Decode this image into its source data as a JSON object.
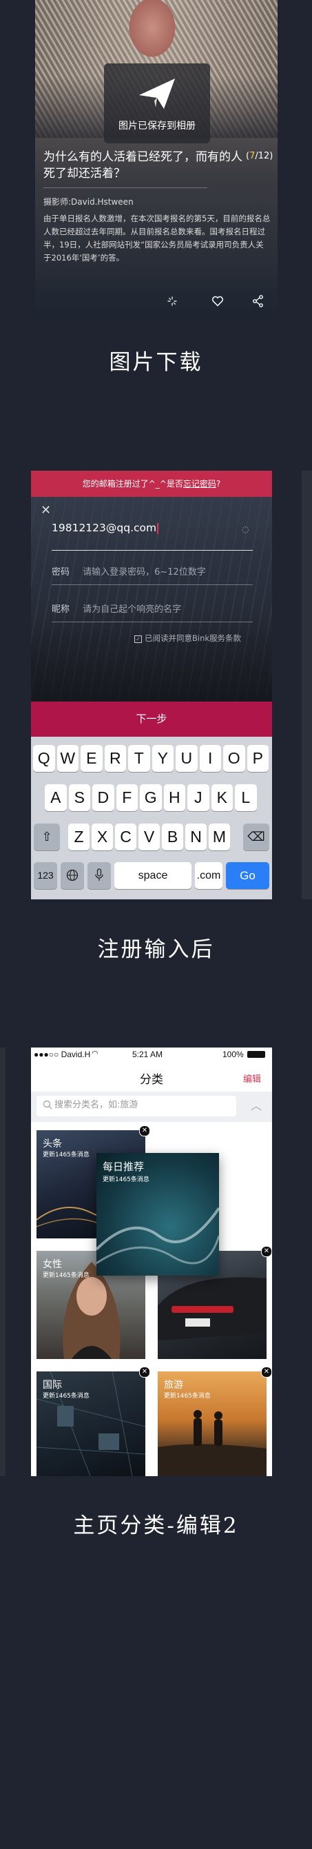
{
  "colors": {
    "page_background": "#1f2430",
    "brand_red": "#c22b4c",
    "next_button": "#b0154a",
    "go_key": "#2a7ef6",
    "edit_red": "#e0324f",
    "pager_highlight": "#f5c84a"
  },
  "section1": {
    "toast_text": "图片已保存到相册",
    "article_title": "为什么有的人活着已经死了，而有的人死了却还活着？",
    "pager_current": "7",
    "pager_total": "/12)",
    "pager_open": "(",
    "photographer": "摄影师:David.Hstween",
    "body": "由于单日报名人数激增，在本次国考报名的第5天，目前的报名总人数已经超过去年同期。从目前报名总数来看。国考报名日程过半，19日，人社部网站刊发“国家公务员局考试录用司负责人关于2016年‘国考’的答。",
    "icons": [
      "loading-icon",
      "heart-icon",
      "share-icon"
    ],
    "caption": "图片下载"
  },
  "section2": {
    "banner_prefix": "您的邮箱注册过了^_^是否",
    "banner_link": "忘记密码",
    "banner_suffix": "?",
    "email_value": "19812123@qq.com",
    "password_label": "密码",
    "password_placeholder": "请输入登录密码，6~12位数字",
    "nickname_label": "昵称",
    "nickname_placeholder": "请为自己起个响亮的名字",
    "agreement": "已阅读并同意Bink服务条款",
    "next_button": "下一步",
    "keyboard": {
      "row1": [
        "Q",
        "W",
        "E",
        "R",
        "T",
        "Y",
        "U",
        "I",
        "O",
        "P"
      ],
      "row2": [
        "A",
        "S",
        "D",
        "F",
        "G",
        "H",
        "J",
        "K",
        "L"
      ],
      "row3": [
        "Z",
        "X",
        "C",
        "V",
        "B",
        "N",
        "M"
      ],
      "num_key": "123",
      "space_key": "space",
      "com_key": ".com",
      "go_key": "Go"
    },
    "caption": "注册输入后"
  },
  "section3": {
    "status": {
      "carrier": "●●●○○ David.H",
      "time": "5:21 AM",
      "battery": "100%"
    },
    "nav_title": "分类",
    "edit": "编辑",
    "search_placeholder": "搜索分类名，如:旅游",
    "cards": [
      {
        "name": "头条",
        "sub": "更新1465条消息"
      },
      {
        "name": "每日推荐",
        "sub": "更新1465条消息"
      },
      {
        "name": "女性",
        "sub": "更新1465条消息"
      },
      {
        "name": "",
        "sub": ""
      },
      {
        "name": "国际",
        "sub": "更新1465条消息"
      },
      {
        "name": "旅游",
        "sub": "更新1465条消息"
      }
    ],
    "caption": "主页分类-编辑2"
  }
}
